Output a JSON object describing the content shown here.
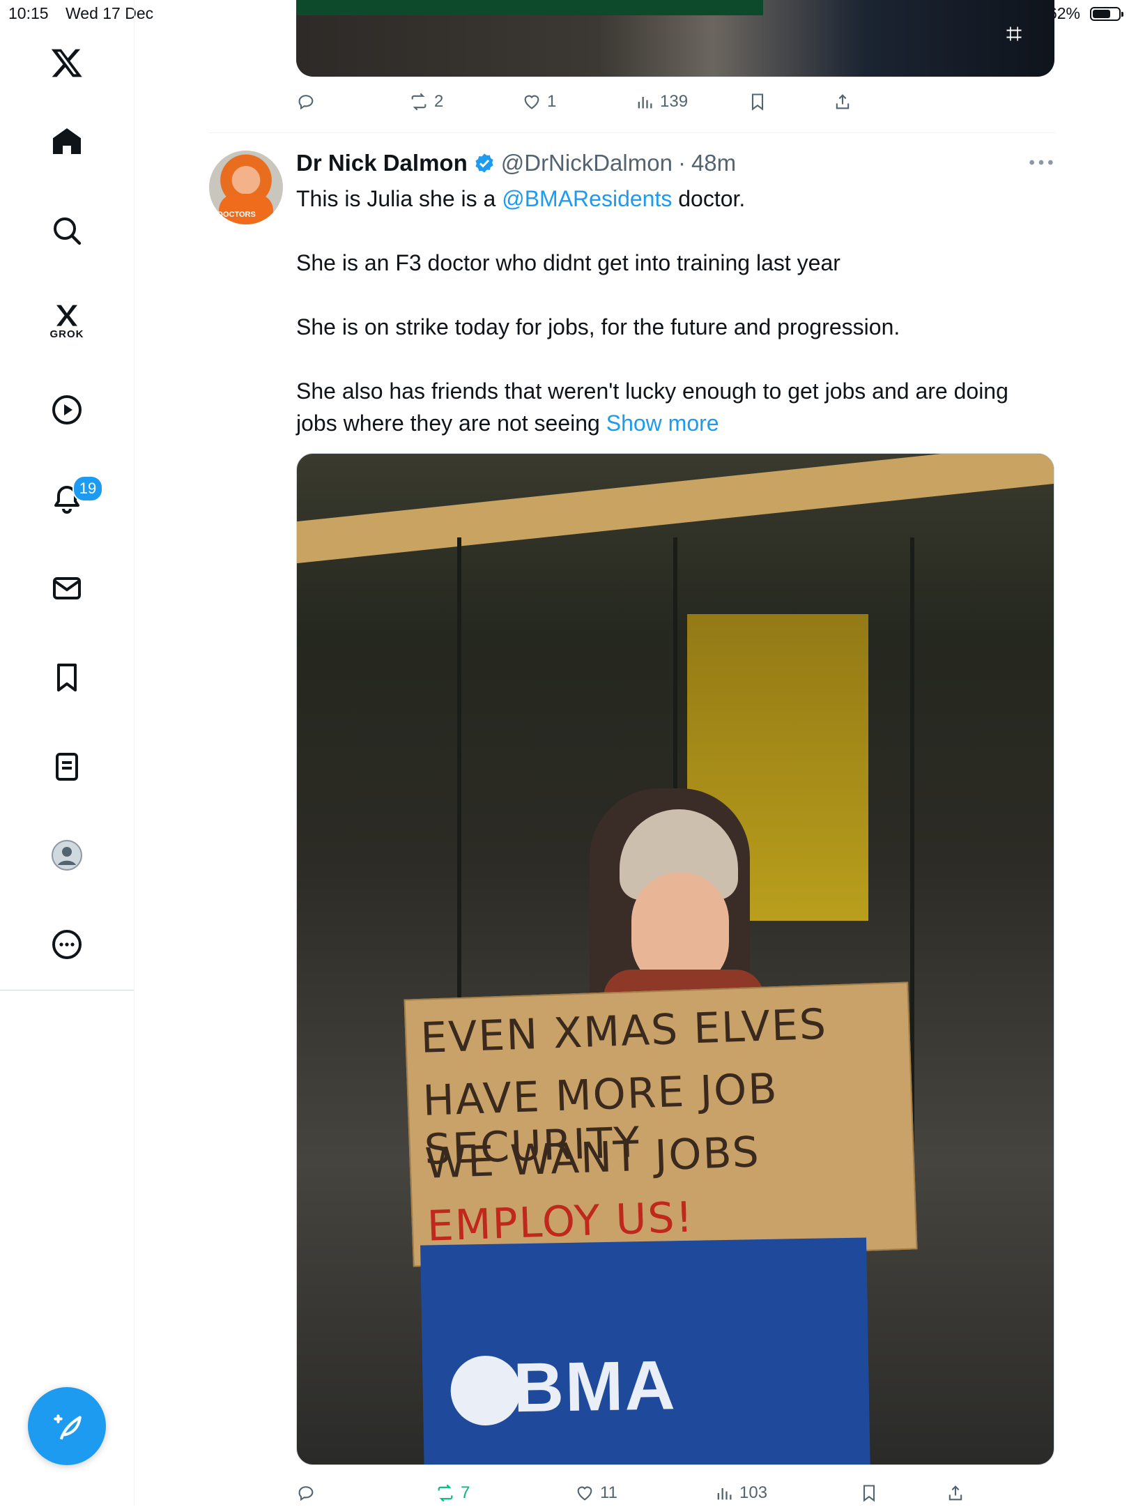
{
  "status_bar": {
    "time": "10:15",
    "date": "Wed 17 Dec",
    "battery": "62%"
  },
  "sidebar": {
    "items": [
      {
        "name": "x-logo"
      },
      {
        "name": "home"
      },
      {
        "name": "explore"
      },
      {
        "name": "grok",
        "label": "GROK"
      },
      {
        "name": "video"
      },
      {
        "name": "notifications",
        "badge": "19"
      },
      {
        "name": "messages"
      },
      {
        "name": "bookmarks"
      },
      {
        "name": "lists"
      },
      {
        "name": "profile"
      },
      {
        "name": "more"
      }
    ],
    "compose": "compose"
  },
  "previous_post": {
    "actions": {
      "reply": "",
      "repost": "2",
      "like": "1",
      "views": "139"
    }
  },
  "post": {
    "author_name": "Dr Nick Dalmon",
    "handle": "@DrNickDalmon",
    "separator": "·",
    "time_ago": "48m",
    "text_line1_a": "This is Julia she is a ",
    "text_line1_mention": "@BMAResidents",
    "text_line1_b": " doctor.",
    "text_p2": "She is an F3 doctor who didnt get into training last year",
    "text_p3": "She is on strike today for jobs, for the future and progression.",
    "text_p4": "She also has friends that weren't lucky enough to get jobs and are doing jobs where they are not seeing ",
    "show_more": "Show more",
    "avatar_text": "DOCTORS",
    "media": {
      "sign_lines": [
        "EVEN XMAS ELVES",
        "HAVE MORE JOB SECURITY",
        "WE WANT JOBS",
        "EMPLOY US!"
      ],
      "flag_text": "BMA"
    },
    "actions": {
      "reply": "",
      "repost": "7",
      "like": "11",
      "views": "103"
    }
  },
  "colors": {
    "accent": "#1d9bf0",
    "repost_active": "#00ba7c",
    "muted": "#536471"
  }
}
